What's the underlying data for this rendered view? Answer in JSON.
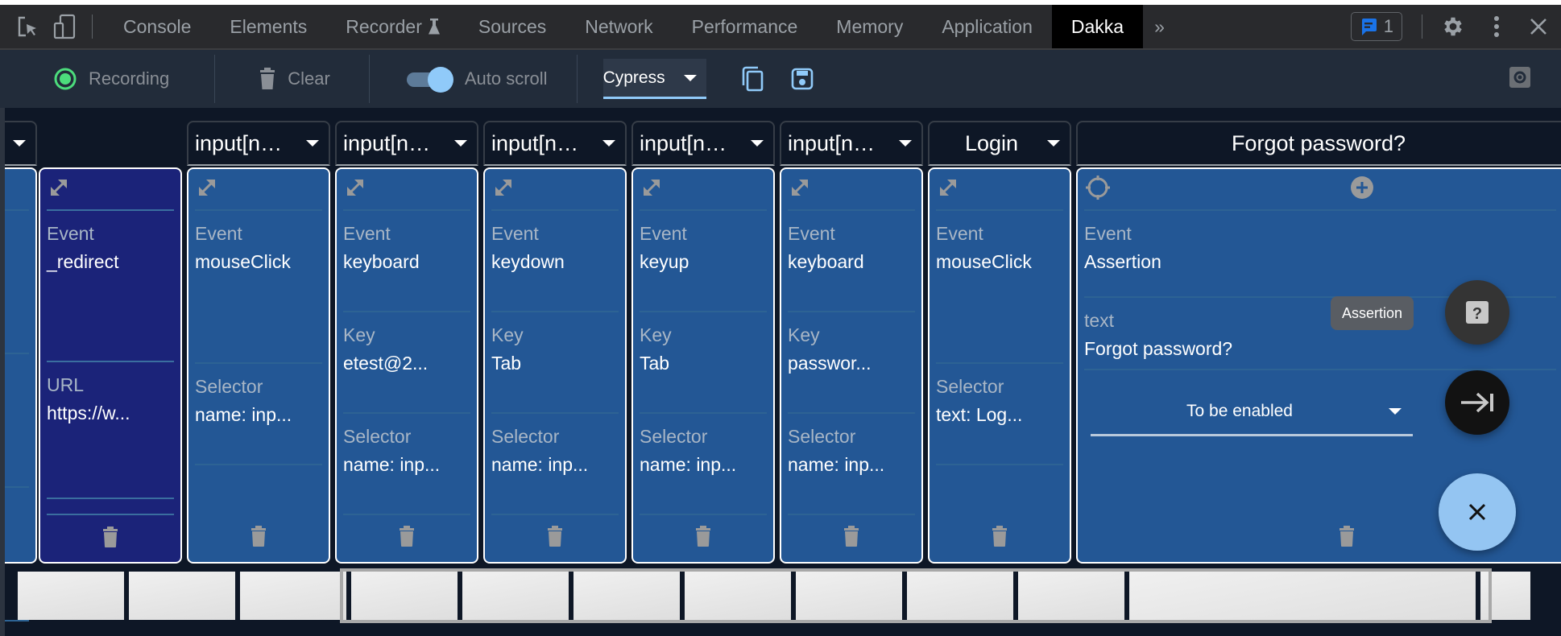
{
  "devtools": {
    "tabs": [
      {
        "label": "Console",
        "active": false
      },
      {
        "label": "Elements",
        "active": false
      },
      {
        "label": "Recorder",
        "active": false,
        "icon": "flask-icon"
      },
      {
        "label": "Sources",
        "active": false
      },
      {
        "label": "Network",
        "active": false
      },
      {
        "label": "Performance",
        "active": false
      },
      {
        "label": "Memory",
        "active": false
      },
      {
        "label": "Application",
        "active": false
      },
      {
        "label": "Dakka",
        "active": true
      }
    ],
    "more_tabs_glyph": "»",
    "issues_count": "1",
    "accent_color": "#1a73e8"
  },
  "toolbar": {
    "recording_label": "Recording",
    "clear_label": "Clear",
    "autoscroll_label": "Auto scroll",
    "autoscroll_on": true,
    "framework": "Cypress",
    "accent_color": "#90caf9"
  },
  "steps": [
    {
      "header": "",
      "partial": true,
      "type": "normal",
      "fields": []
    },
    {
      "header": null,
      "type": "redirect",
      "fields": [
        {
          "label": "Event",
          "value": "_redirect"
        },
        {
          "label": "URL",
          "value": "https://w..."
        }
      ]
    },
    {
      "header": "input[n…",
      "type": "normal",
      "fields": [
        {
          "label": "Event",
          "value": "mouseClick"
        },
        {
          "label": "Selector",
          "value": "name: inp..."
        }
      ]
    },
    {
      "header": "input[n…",
      "type": "normal",
      "fields": [
        {
          "label": "Event",
          "value": "keyboard"
        },
        {
          "label": "Key",
          "value": "etest@2..."
        },
        {
          "label": "Selector",
          "value": "name: inp..."
        }
      ]
    },
    {
      "header": "input[n…",
      "type": "normal",
      "fields": [
        {
          "label": "Event",
          "value": "keydown"
        },
        {
          "label": "Key",
          "value": "Tab"
        },
        {
          "label": "Selector",
          "value": "name: inp..."
        }
      ]
    },
    {
      "header": "input[n…",
      "type": "normal",
      "fields": [
        {
          "label": "Event",
          "value": "keyup"
        },
        {
          "label": "Key",
          "value": "Tab"
        },
        {
          "label": "Selector",
          "value": "name: inp..."
        }
      ]
    },
    {
      "header": "input[n…",
      "type": "normal",
      "fields": [
        {
          "label": "Event",
          "value": "keyboard"
        },
        {
          "label": "Key",
          "value": "passwor..."
        },
        {
          "label": "Selector",
          "value": "name: inp..."
        }
      ]
    },
    {
      "header": "Login",
      "type": "normal",
      "fields": [
        {
          "label": "Event",
          "value": "mouseClick"
        },
        {
          "label": "Selector",
          "value": "text: Log..."
        }
      ]
    },
    {
      "header": "Forgot password?",
      "type": "assertion",
      "fields": [
        {
          "label": "Event",
          "value": "Assertion"
        },
        {
          "label": "text",
          "value": "Forgot password?"
        }
      ],
      "assertion_option": "To be enabled"
    }
  ],
  "fabs": {
    "tooltip": "Assertion",
    "help_glyph": "?",
    "next_glyph": "→|",
    "close_glyph": "×"
  },
  "minimap": {
    "cells": 13
  }
}
